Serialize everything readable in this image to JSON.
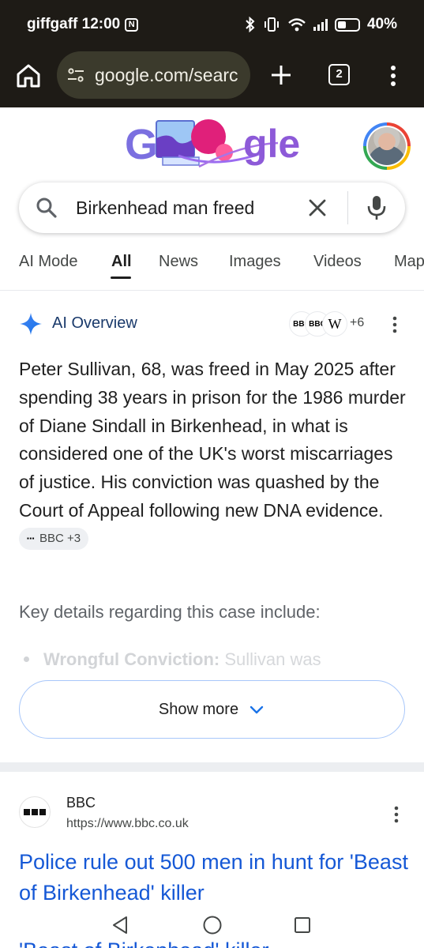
{
  "status_bar": {
    "carrier_time": "giffgaff 12:00",
    "nfc_glyph": "N",
    "battery": "40%",
    "icons": [
      "bluetooth-icon",
      "vibrate-icon",
      "wifi-icon",
      "signal-icon",
      "battery-icon"
    ]
  },
  "browser": {
    "url": "google.com/searc",
    "tab_count": "2",
    "icons": [
      "home-icon",
      "site-settings-icon",
      "new-tab-icon",
      "tabs-icon",
      "more-icon"
    ]
  },
  "search": {
    "query": "Birkenhead man freed",
    "icons": [
      "search-icon",
      "clear-icon",
      "mic-icon"
    ]
  },
  "tabs": [
    {
      "label": "AI Mode",
      "active": false
    },
    {
      "label": "All",
      "active": true
    },
    {
      "label": "News",
      "active": false
    },
    {
      "label": "Images",
      "active": false
    },
    {
      "label": "Videos",
      "active": false
    },
    {
      "label": "Maps",
      "active": false
    }
  ],
  "ai_overview": {
    "title": "AI Overview",
    "source_logos": [
      "BBC",
      "BBC",
      "W"
    ],
    "source_count": "+6",
    "body": "Peter Sullivan, 68, was freed in May 2025 after spending 38 years in prison for the 1986 murder of Diane Sindall in Birkenhead, in what is considered one of the UK's worst miscarriages of justice. His conviction was quashed by the Court of Appeal following new DNA evidence.",
    "citation": "BBC +3",
    "key_details": "Key details regarding this case include:",
    "faded_item_bold": "Wrongful Conviction:",
    "faded_item_text": " Sullivan was",
    "show_more": "Show more"
  },
  "result": {
    "site_name": "BBC",
    "url": "https://www.bbc.co.uk",
    "title": "Police rule out 500 men in hunt for 'Beast of Birkenhead' killer",
    "next_title_peek": "'Beast of Birkenhead' killer"
  },
  "colors": {
    "chrome_bg": "#1e1b16",
    "link_blue": "#1558d6",
    "accent_blue": "#a8c7fa",
    "ai_title": "#1a3a6b"
  }
}
